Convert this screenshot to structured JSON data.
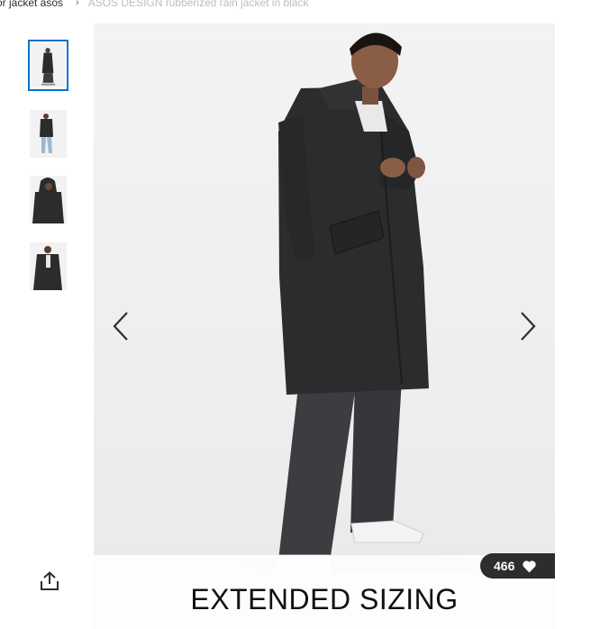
{
  "breadcrumb": {
    "parent": "or jacket asos",
    "separator": "›",
    "current": "ASOS DESIGN rubberized rain jacket in black"
  },
  "gallery": {
    "thumbnail_count": 4,
    "active_index": 0,
    "banner_text": "EXTENDED SIZING",
    "saves_count": "466",
    "icons": {
      "prev": "chevron-left-icon",
      "next": "chevron-right-icon",
      "saves": "heart-icon",
      "share": "share-icon"
    }
  },
  "colors": {
    "accent": "#0770cf",
    "badge_bg": "#2d2d2d",
    "coat": "#2a2c2e"
  }
}
